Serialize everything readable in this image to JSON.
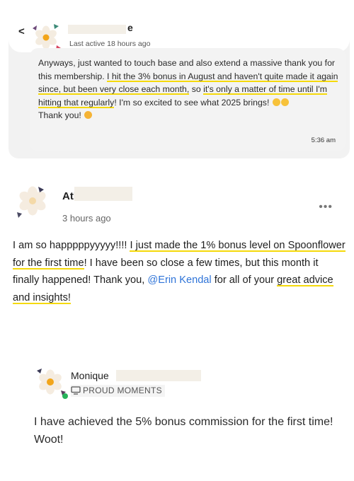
{
  "message_card": {
    "back_icon": "chevron-left-icon",
    "name_suffix": "e",
    "last_active": "Last active 18 hours ago",
    "body": {
      "p1": "Anyways, just wanted to touch base and also extend a massive thank you for this membership. ",
      "h1": "I hit the 3% bonus in August and haven't quite made it again since, but been very close each month,",
      "p2": " so ",
      "h2": "it's only a matter of time until I'm hitting that regularly",
      "p3": "!  I'm so excited to see what 2025 brings! ",
      "p4": "Thank you! "
    },
    "time": "5:36 am",
    "highlight_color": "#f5d90a"
  },
  "post_card": {
    "name": "Atl",
    "time": "3 hours ago",
    "more_icon": "more-horizontal-icon",
    "body": {
      "p1": "I am so happpppyyyyy!!!! ",
      "h1": "I just made the 1% bonus level on Spoonflower for the first time",
      "p2": "! I have been so close a few times, but this month it finally happened! Thank you, ",
      "mention": "@Erin Kendal",
      "p3": " for all of your ",
      "h2": "great advice and insights!"
    },
    "mention_color": "#2f74d8"
  },
  "proud_card": {
    "name": "Monique",
    "category": "PROUD MOMENTS",
    "category_icon": "monitor-icon",
    "body": "I have achieved the 5% bonus commission for the first time! Woot!"
  }
}
